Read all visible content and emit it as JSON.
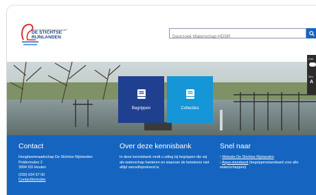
{
  "header": {
    "logo_small": "HOOGHEEMRAADSCHAP",
    "logo_line1": "DE STICHTSE",
    "logo_line2": "RIJNLANDEN",
    "search_placeholder": "Doorzoek Waterschap HDSR"
  },
  "tiles": [
    {
      "label": "Begrippen",
      "color": "#1f3f8f"
    },
    {
      "label": "Collecties",
      "color": "#1596d6"
    }
  ],
  "side_panel": {
    "a": "Con",
    "b": "Gro",
    "c": "A"
  },
  "footer": {
    "contact": {
      "title": "Contact",
      "org": "Hoogheemraadschap De Stichtse Rijnlanden",
      "street": "Poldermolen 2",
      "city": "3994 DD Houten",
      "phone": "(030) 634 57 00",
      "form_link": "Contactformulier"
    },
    "about": {
      "title": "Over deze kennisbank",
      "text": "In deze kennisbank vindt u uitleg bij begrippen die wij als waterschap hanteren en waarvan de betekenis niet altijd vanzelfsprekend is."
    },
    "quick": {
      "title": "Snel naar",
      "link1": "Website De Stichtse Rijnlanden",
      "link2": "Aquo-standaard",
      "link2_suffix": " (begrippenstandaard voor alle waterschappen)"
    }
  },
  "colors": {
    "footer": "#1565c0",
    "accent": "#1565c0"
  }
}
